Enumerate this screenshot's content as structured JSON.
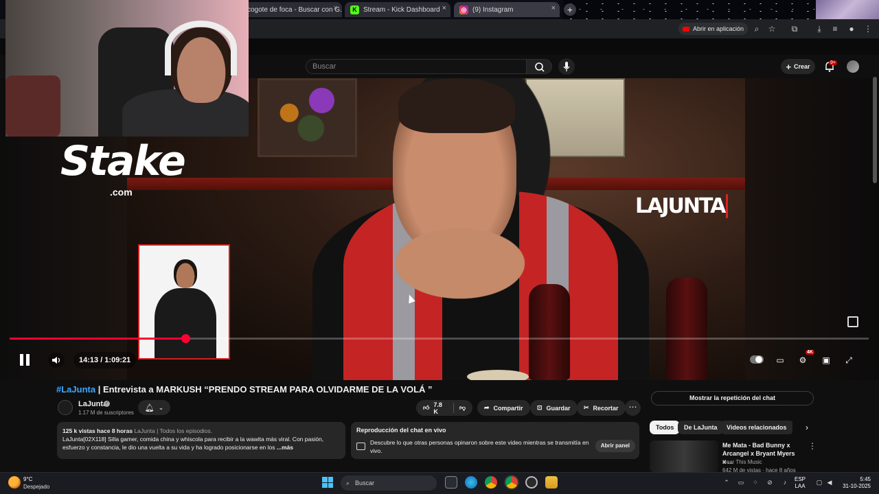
{
  "browser": {
    "tabs": [
      {
        "label": "cogote de foca - Buscar con G...",
        "favicon": "google"
      },
      {
        "label": "Stream - Kick Dashboard",
        "favicon": "kick"
      },
      {
        "label": "(9) Instagram",
        "favicon": "instagram"
      }
    ],
    "open_in_app": "Abrir en aplicación"
  },
  "youtube": {
    "search_placeholder": "Buscar",
    "create_label": "Crear",
    "notifications_badge": "9+"
  },
  "overlays": {
    "stake_logo": "Stake",
    "stake_domain": ".com",
    "lajunta_logo": "LAJUNTA"
  },
  "player": {
    "current_time": "14:13",
    "duration": "1:09:21",
    "time_display": "14:13 / 1:09:21",
    "progress_fraction": 0.205,
    "quality_badge": "4K"
  },
  "video": {
    "hashtag": "#LaJunta",
    "title_rest": " | Entrevista a MARKUSH “PRENDO STREAM PARA OLVIDARME DE LA VOLÁ ”",
    "channel_name": "LaJunta",
    "subscribers": "1.17 M de suscriptores",
    "likes": "7.8 K",
    "share_label": "Compartir",
    "save_label": "Guardar",
    "clip_label": "Recortar"
  },
  "description": {
    "meta": "125 k vistas  hace 8 horas",
    "hashtags": "LaJunta | Todos los episodios.",
    "text": "LaJunta[02X118] Silla gamer, comida china y whiscola para recibir a la wawita más viral. Con pasión, esfuerzo y constancia, le dio una vuelta a su vida y ha logrado posicionarse en los",
    "more": "...más"
  },
  "chat_replay": {
    "title": "Reproducción del chat en vivo",
    "text": "Descubre lo que otras personas opinaron sobre este video mientras se transmitía en vivo.",
    "open_panel": "Abrir panel",
    "show_button": "Mostrar la repetición del chat"
  },
  "related": {
    "chips": [
      "Todos",
      "De LaJunta",
      "Videos relacionados"
    ],
    "active_chip": "Todos",
    "first": {
      "title": "Me Mata - Bad Bunny x Arcangel x Bryant Myers x ...",
      "channel": "Hear This Music",
      "meta": "642 M de vistas · hace 8 años"
    }
  },
  "taskbar": {
    "temperature": "9°C",
    "weather": "Despejado",
    "search_label": "Buscar",
    "lang_primary": "ESP",
    "lang_secondary": "LAA",
    "time": "5:45",
    "date": "31-10-2025"
  }
}
